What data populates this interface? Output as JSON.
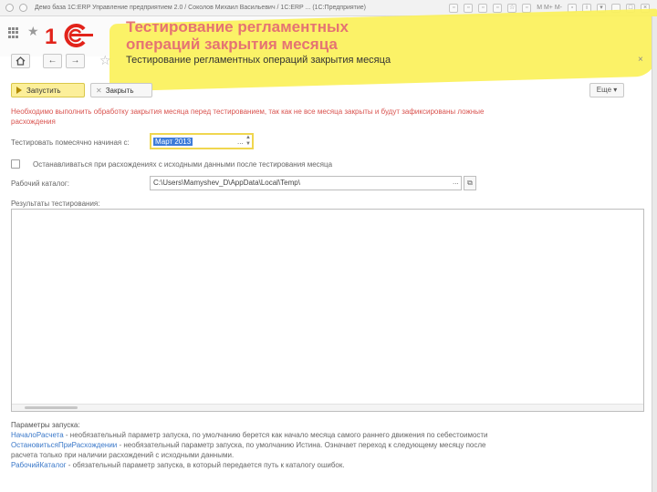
{
  "window": {
    "title": "Демо база 1С:ERP Управление предприятием 2.0 / Соколов Михаил Васильевич / 1С:ERP ... (1С:Предприятие)",
    "right_m": "M M+ M-"
  },
  "slide": {
    "title_line1": "Тестирование регламентных",
    "title_line2": "операций закрытия месяца"
  },
  "nav": {
    "back": "←",
    "forward": "→",
    "form_title": "Тестирование регламентных операций закрытия месяца",
    "close": "×"
  },
  "commands": {
    "run": "Запустить",
    "close": "Закрыть",
    "more": "Еще ▾"
  },
  "warning": {
    "line1": "Необходимо выполнить обработку закрытия месяца перед тестированием, так как не все месяца закрыты и будут зафиксированы ложные",
    "line2": "расхождения"
  },
  "form": {
    "month_label": "Тестировать помесячно начиная с:",
    "month_value": "Март 2013",
    "month_dots": "...",
    "month_spin": "▲\n▼",
    "stop_label": "Останавливаться при расхождениях с исходными данными после тестирования месяца",
    "stop_checked": false,
    "dir_label": "Рабочий каталог:",
    "dir_value": "C:\\Users\\Mamyshev_D\\AppData\\Local\\Temp\\",
    "dir_dots": "...",
    "results_label": "Результаты тестирования:"
  },
  "params": {
    "heading": "Параметры запуска:",
    "items": [
      {
        "name": "НачалоРасчета",
        "text": " - необязательный параметр запуска, по умолчанию берется как начало месяца самого раннего движения по себестоимости"
      },
      {
        "name": "ОстановитьсяПриРасхождении",
        "text": " - необязательный параметр запуска, по умолчанию Истина. Означает переход к следующему месяцу после"
      },
      {
        "name": "",
        "text": "расчета только при наличии расхождений с исходными данными."
      },
      {
        "name": "РабочийКаталог",
        "text": " - обязательный параметр запуска, в который передается путь к каталогу ошибок."
      }
    ]
  },
  "colors": {
    "accent_yellow": "#fcef9a",
    "highlighter": "#fbf15a",
    "title_red": "#e57373",
    "warning_red": "#d9534f",
    "link_blue": "#3a78c9",
    "selection_blue": "#3d7bd9",
    "logo_red": "#e2231a"
  }
}
